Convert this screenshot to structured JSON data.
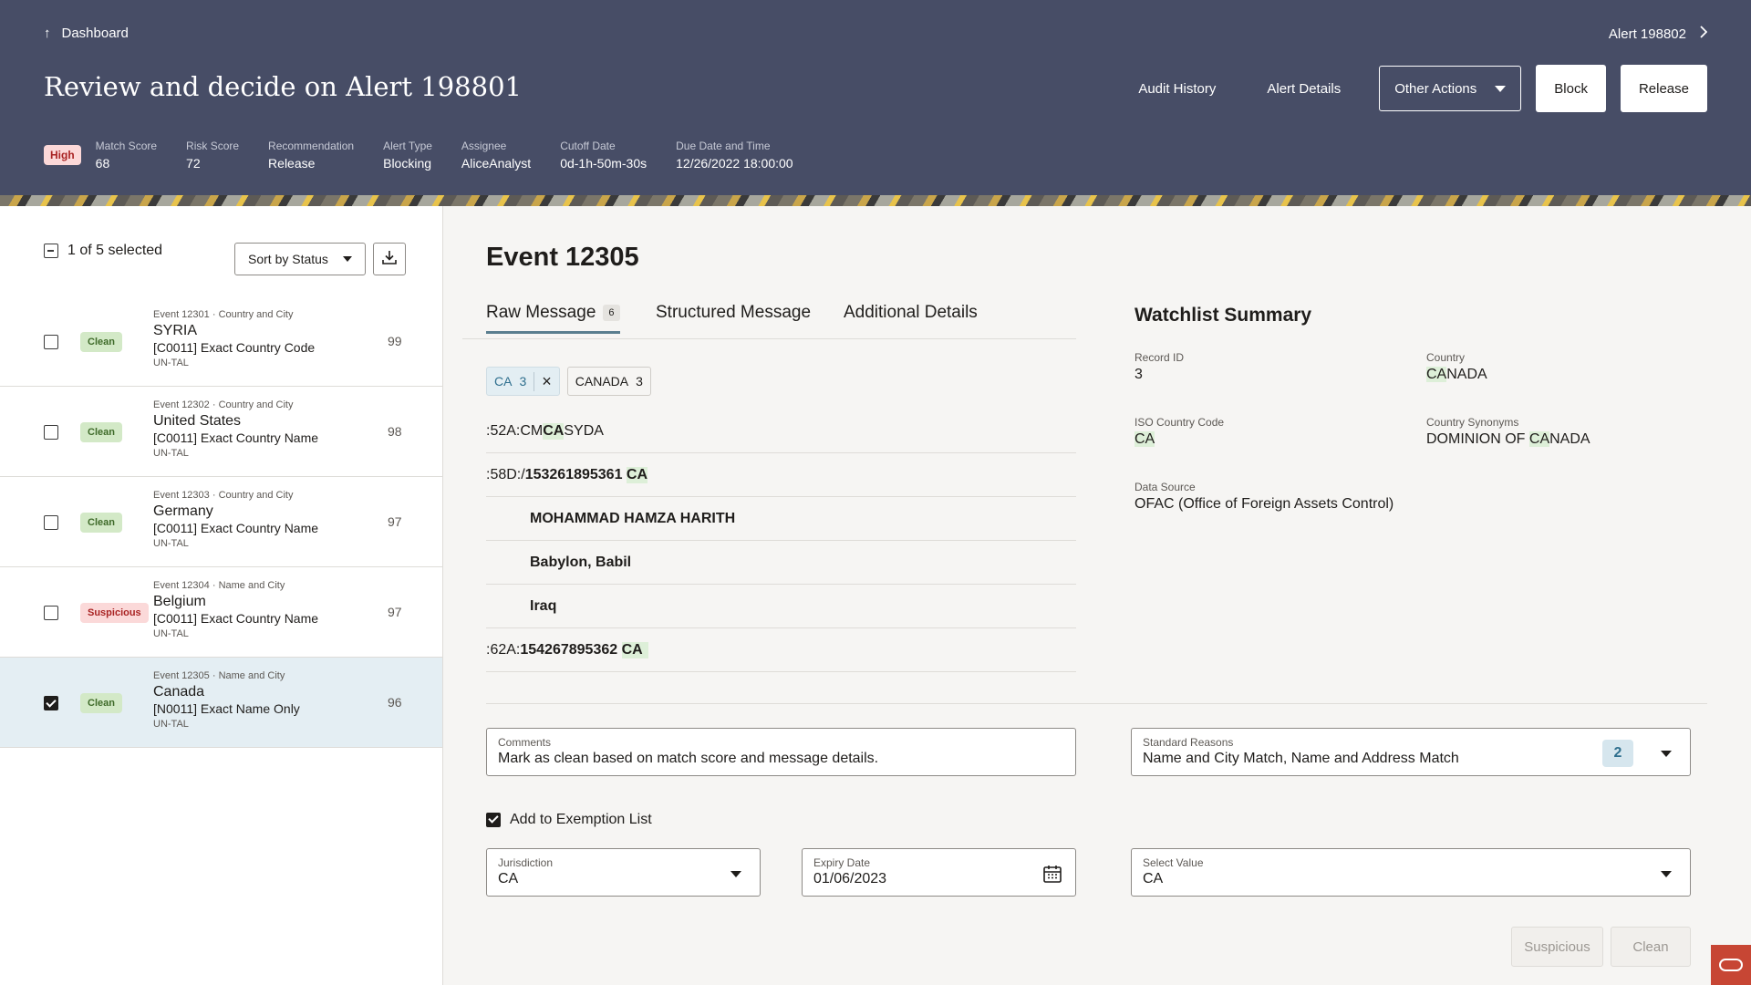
{
  "header": {
    "breadcrumb": "Dashboard",
    "next_alert": "Alert 198802",
    "title": "Review and decide on Alert 198801",
    "actions": {
      "audit_history": "Audit History",
      "alert_details": "Alert Details",
      "other_actions": "Other Actions",
      "block": "Block",
      "release": "Release"
    },
    "priority": "High",
    "meta": [
      {
        "label": "Match Score",
        "value": "68"
      },
      {
        "label": "Risk Score",
        "value": "72"
      },
      {
        "label": "Recommendation",
        "value": "Release"
      },
      {
        "label": "Alert Type",
        "value": "Blocking"
      },
      {
        "label": "Assignee",
        "value": "AliceAnalyst"
      },
      {
        "label": "Cutoff Date",
        "value": "0d-1h-50m-30s"
      },
      {
        "label": "Due Date and Time",
        "value": "12/26/2022 18:00:00"
      }
    ]
  },
  "list": {
    "selection": "1 of 5 selected",
    "sort_label": "Sort by Status",
    "items": [
      {
        "event": "Event 12301",
        "type": "Country and City",
        "status": "Clean",
        "name": "SYRIA",
        "rule": "[C0011] Exact Country Code",
        "list": "UN-TAL",
        "score": "99",
        "checked": false
      },
      {
        "event": "Event 12302",
        "type": "Country and City",
        "status": "Clean",
        "name": "United States",
        "rule": "[C0011] Exact Country Name",
        "list": "UN-TAL",
        "score": "98",
        "checked": false
      },
      {
        "event": "Event 12303",
        "type": "Country and City",
        "status": "Clean",
        "name": "Germany",
        "rule": "[C0011] Exact Country Name",
        "list": "UN-TAL",
        "score": "97",
        "checked": false
      },
      {
        "event": "Event 12304",
        "type": "Name and City",
        "status": "Suspicious",
        "name": "Belgium",
        "rule": "[C0011] Exact Country Name",
        "list": "UN-TAL",
        "score": "97",
        "checked": false
      },
      {
        "event": "Event 12305",
        "type": "Name and City",
        "status": "Clean",
        "name": "Canada",
        "rule": "[N0011] Exact Name Only",
        "list": "UN-TAL",
        "score": "96",
        "checked": true
      }
    ]
  },
  "detail": {
    "title": "Event 12305",
    "tabs": {
      "raw": "Raw Message",
      "raw_count": "6",
      "structured": "Structured Message",
      "additional": "Additional Details"
    },
    "chips": [
      {
        "label": "CA",
        "count": "3"
      },
      {
        "label": "CANADA",
        "count": "3"
      }
    ],
    "message": {
      "l1_pre": ":52A:CM",
      "l1_hl": "CA",
      "l1_post": "SYDA",
      "l2_pre": ":58D:/",
      "l2_bold": "153261895361",
      "l2_hl": "CA",
      "l3": "MOHAMMAD HAMZA HARITH",
      "l4": "Babylon, Babil",
      "l5": "Iraq",
      "l6_pre": ":62A:",
      "l6_bold": "154267895362",
      "l6_hl": "CA"
    },
    "watchlist": {
      "title": "Watchlist Summary",
      "record_id_label": "Record ID",
      "record_id": "3",
      "country_label": "Country",
      "country_hl": "CA",
      "country_rest": "NADA",
      "iso_label": "ISO Country Code",
      "iso": "CA",
      "synonyms_label": "Country Synonyms",
      "synonyms_pre": "DOMINION OF ",
      "synonyms_hl": "CA",
      "synonyms_post": "NADA",
      "source_label": "Data Source",
      "source": "OFAC (Office of Foreign Assets Control)"
    },
    "form": {
      "comments_label": "Comments",
      "comments": "Mark as clean based on match score and message details.",
      "reasons_label": "Standard Reasons",
      "reasons": "Name and City Match, Name and Address Match",
      "reasons_count": "2",
      "exempt_label": "Add to Exemption List",
      "jurisdiction_label": "Jurisdiction",
      "jurisdiction": "CA",
      "expiry_label": "Expiry Date",
      "expiry": "01/06/2023",
      "select_label": "Select Value",
      "select": "CA",
      "suspicious": "Suspicious",
      "clean": "Clean"
    }
  },
  "colors": {
    "header_bg": "#474d66",
    "clean_badge": "#d3e9c7",
    "suspicious_badge": "#fbd9d9",
    "highlight": "#ddefd8",
    "oracle_red": "#c74634"
  }
}
